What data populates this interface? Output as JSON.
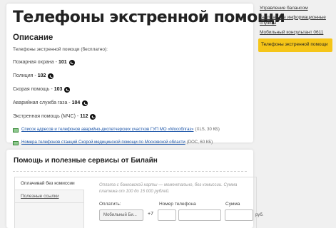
{
  "main": {
    "title": "Телефоны экстренной помощи",
    "section_title": "Описание",
    "intro": "Телефоны экстренной помощи (бесплатно):",
    "services": [
      {
        "label": "Пожарная охрана -",
        "number": "101"
      },
      {
        "label": "Полиция -",
        "number": "102"
      },
      {
        "label": "Скорая помощь -",
        "number": "103"
      },
      {
        "label": "Аварийная служба газа -",
        "number": "104"
      },
      {
        "label": "Экстренная помощь (МЧС) -",
        "number": "112"
      }
    ],
    "documents": [
      {
        "link": "Список адресов и телефонов аварийно-диспетчерских участков ГУП МО «Мособлгаз»",
        "meta": "(XLS, 30 КБ)"
      },
      {
        "link": "Номера телефонов станций Скорой медицинской помощи по Московской области",
        "meta": "(DOC, 60 КБ)"
      }
    ]
  },
  "services_block": {
    "title": "Помощь и полезные сервисы от Билайн",
    "tabs": [
      "Оплачивай без комиссии",
      "Полезные ссылки"
    ],
    "pay_note": "Оплата с банковской карты — моментально, без комиссии. Сумма платежа от 100 до 15 000 рублей.",
    "labels": {
      "pay": "Оплатить:",
      "phone": "Номер телефона",
      "amount": "Сумма"
    },
    "select_value": "Мобильный Би...",
    "phone_prefix": "+7",
    "currency": "руб."
  },
  "sidebar": {
    "items": [
      {
        "label": "Управление балансом",
        "active": false
      },
      {
        "label": "Бесплатные информационные службы",
        "active": false
      },
      {
        "label": "Мобильный консультант 0611",
        "active": false
      },
      {
        "label": "Телефоны экстренной помощи",
        "active": true
      }
    ]
  },
  "colors": {
    "accent": "#f5c518",
    "link": "#1c55a8"
  },
  "icons": [
    "phone-icon",
    "spreadsheet-icon"
  ]
}
